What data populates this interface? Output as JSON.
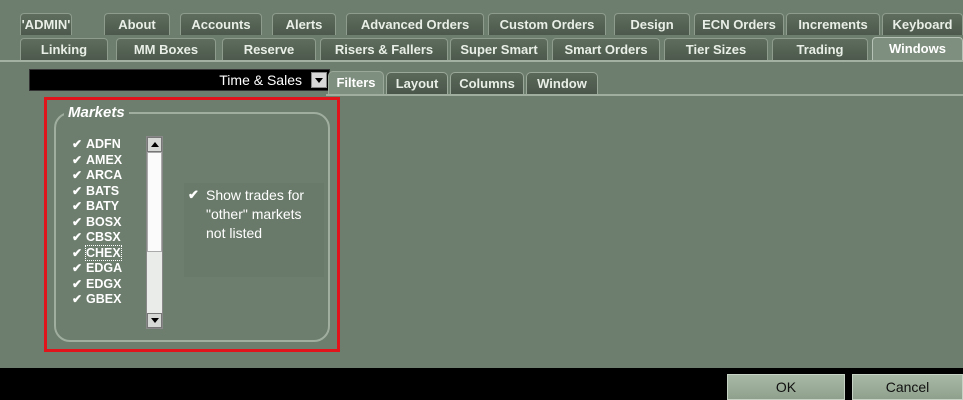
{
  "tabs_row1": [
    "'ADMIN'",
    "About",
    "Accounts",
    "Alerts",
    "Advanced Orders",
    "Custom Orders",
    "Design",
    "ECN Orders",
    "Increments",
    "Keyboard"
  ],
  "tabs_row2": [
    "Linking",
    "MM Boxes",
    "Reserve",
    "Risers & Fallers",
    "Super Smart",
    "Smart Orders",
    "Tier Sizes",
    "Trading",
    "Windows"
  ],
  "active_tab": "Windows",
  "window_select": {
    "value": "Time & Sales"
  },
  "subtabs": [
    "Filters",
    "Layout",
    "Columns",
    "Window"
  ],
  "active_subtab": "Filters",
  "markets": {
    "title": "Markets",
    "items": [
      {
        "label": "ADFN",
        "checked": true
      },
      {
        "label": "AMEX",
        "checked": true
      },
      {
        "label": "ARCA",
        "checked": true
      },
      {
        "label": "BATS",
        "checked": true
      },
      {
        "label": "BATY",
        "checked": true
      },
      {
        "label": "BOSX",
        "checked": true
      },
      {
        "label": "CBSX",
        "checked": true
      },
      {
        "label": "CHEX",
        "checked": true
      },
      {
        "label": "EDGA",
        "checked": true
      },
      {
        "label": "EDGX",
        "checked": true
      },
      {
        "label": "GBEX",
        "checked": true
      }
    ],
    "focused_item": "CHEX",
    "other_markets_label": "Show trades for \"other\" markets not listed",
    "other_markets_checked": true
  },
  "colors": {
    "panel": "#6e7e6e",
    "highlight": "#e0141a"
  },
  "buttons": {
    "ok": "OK",
    "cancel": "Cancel"
  }
}
